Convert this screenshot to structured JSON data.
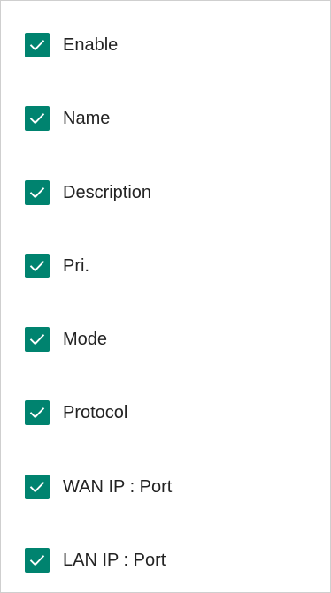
{
  "colors": {
    "checkbox_fill": "#00836f",
    "check_mark": "#ffffff",
    "label_text": "#232323",
    "panel_border": "#cfcfcf"
  },
  "columns": [
    {
      "label": "Enable",
      "checked": true,
      "icon": "check-icon"
    },
    {
      "label": "Name",
      "checked": true,
      "icon": "check-icon"
    },
    {
      "label": "Description",
      "checked": true,
      "icon": "check-icon"
    },
    {
      "label": "Pri.",
      "checked": true,
      "icon": "check-icon"
    },
    {
      "label": "Mode",
      "checked": true,
      "icon": "check-icon"
    },
    {
      "label": "Protocol",
      "checked": true,
      "icon": "check-icon"
    },
    {
      "label": "WAN IP : Port",
      "checked": true,
      "icon": "check-icon"
    },
    {
      "label": "LAN IP : Port",
      "checked": true,
      "icon": "check-icon"
    }
  ]
}
